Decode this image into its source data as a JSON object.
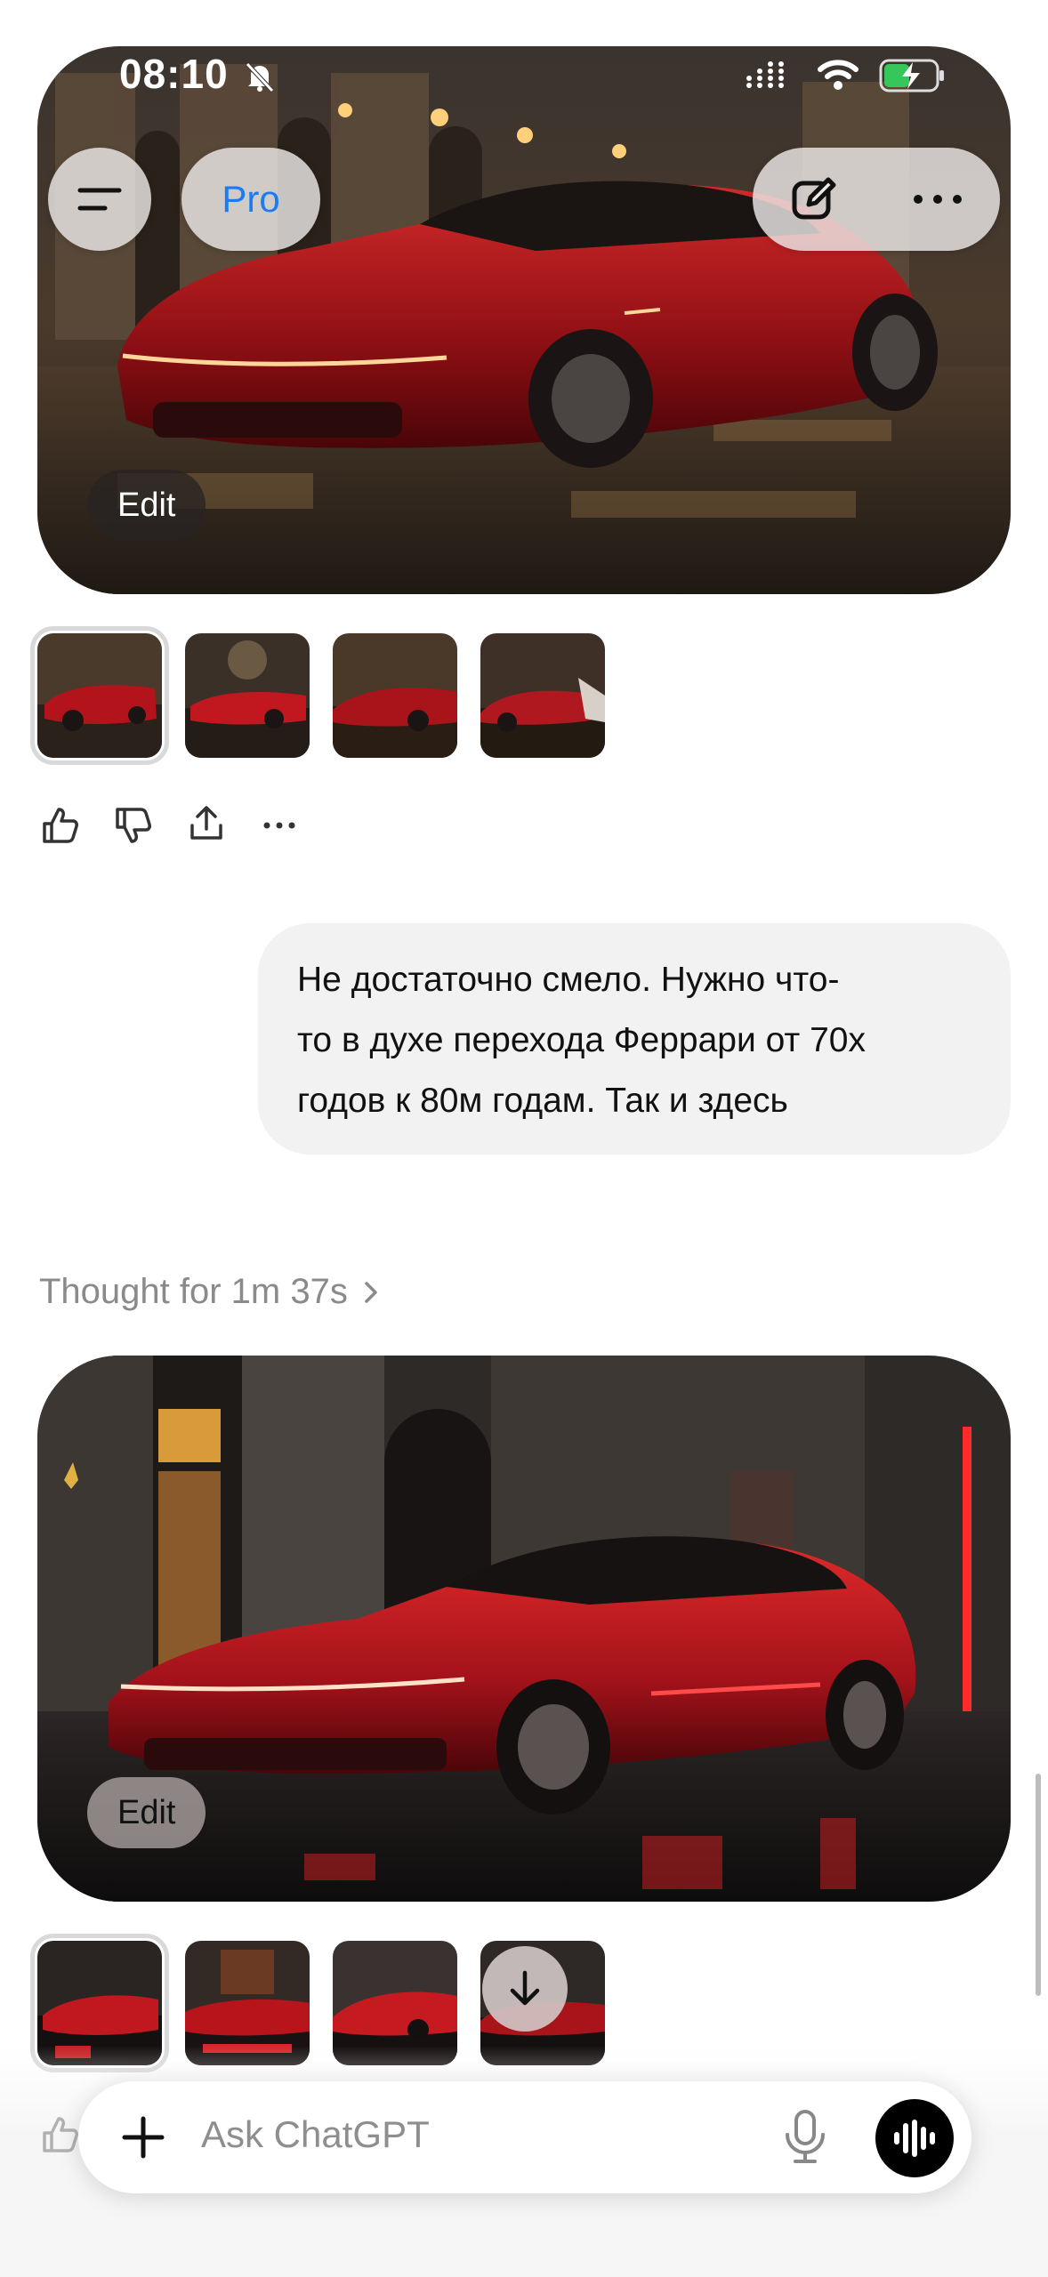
{
  "status_bar": {
    "time": "08:10",
    "icons": [
      "bell-slash-icon",
      "cellular-signal-icon",
      "wifi-icon",
      "battery-charging-icon"
    ]
  },
  "header": {
    "pro_label": "Pro",
    "icons": [
      "menu-icon",
      "new-chat-icon",
      "more-icon"
    ]
  },
  "image_response_1": {
    "edit_label": "Edit",
    "thumbnail_count": 4,
    "selected_thumbnail": 1
  },
  "actions": {
    "icons": [
      "thumbs-up-icon",
      "thumbs-down-icon",
      "share-icon",
      "more-icon"
    ]
  },
  "user_message": {
    "lines": [
      "Не достаточно смело. Нужно что-",
      "то в духе перехода Феррари от 70х",
      "годов к 80м годам. Так и здесь"
    ]
  },
  "thought": {
    "label": "Thought for 1m 37s"
  },
  "image_response_2": {
    "edit_label": "Edit",
    "thumbnail_count": 4,
    "selected_thumbnail": 1
  },
  "composer": {
    "placeholder": "Ask ChatGPT",
    "icons": [
      "plus-icon",
      "microphone-icon",
      "voice-mode-icon",
      "scroll-down-arrow-icon"
    ]
  },
  "colors": {
    "accent_blue": "#1a7cf0",
    "car_red": "#b3141c",
    "bubble_bg": "#f2f2f2"
  }
}
